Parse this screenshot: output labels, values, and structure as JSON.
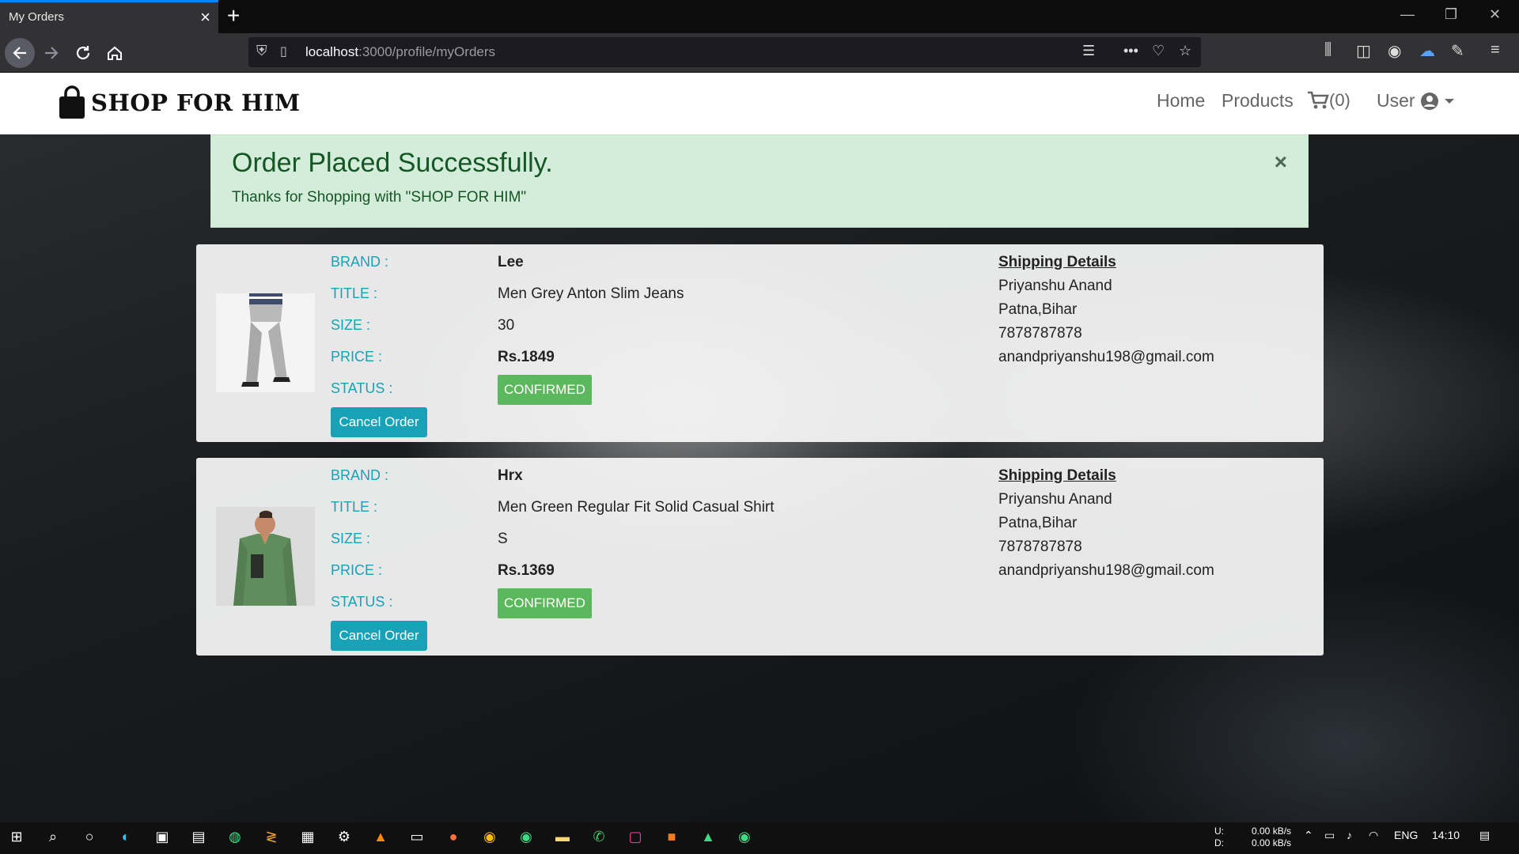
{
  "browser": {
    "tab_title": "My Orders",
    "url_host": "localhost",
    "url_path": ":3000/profile/myOrders"
  },
  "site": {
    "brand": "SHOP FOR HIM",
    "nav": {
      "home": "Home",
      "products": "Products",
      "cart_count": "(0)",
      "user": "User"
    }
  },
  "alert": {
    "title": "Order Placed Successfully.",
    "message": "Thanks for Shopping with \"SHOP FOR HIM\"",
    "close": "×"
  },
  "labels": {
    "brand": "BRAND :",
    "title": "TITLE :",
    "size": "SIZE :",
    "price": "PRICE :",
    "status": "STATUS :",
    "cancel": "Cancel Order",
    "shipping_heading": "Shipping Details"
  },
  "orders": [
    {
      "brand": "Lee",
      "title": "Men Grey Anton Slim Jeans",
      "size": "30",
      "price": "Rs.1849",
      "status": "CONFIRMED",
      "shipping": {
        "name": "Priyanshu Anand",
        "city": "Patna,Bihar",
        "phone": "7878787878",
        "email": "anandpriyanshu198@gmail.com"
      }
    },
    {
      "brand": "Hrx",
      "title": "Men Green Regular Fit Solid Casual Shirt",
      "size": "S",
      "price": "Rs.1369",
      "status": "CONFIRMED",
      "shipping": {
        "name": "Priyanshu Anand",
        "city": "Patna,Bihar",
        "phone": "7878787878",
        "email": "anandpriyanshu198@gmail.com"
      }
    }
  ],
  "taskbar": {
    "upload_label": "U:",
    "download_label": "D:",
    "upload_speed": "0.00 kB/s",
    "download_speed": "0.00 kB/s",
    "language": "ENG",
    "time": "14:10"
  },
  "colors": {
    "accent": "#17a2b8",
    "status_confirmed": "#5cb85c",
    "alert_bg": "#d4edda",
    "alert_text": "#155724"
  }
}
